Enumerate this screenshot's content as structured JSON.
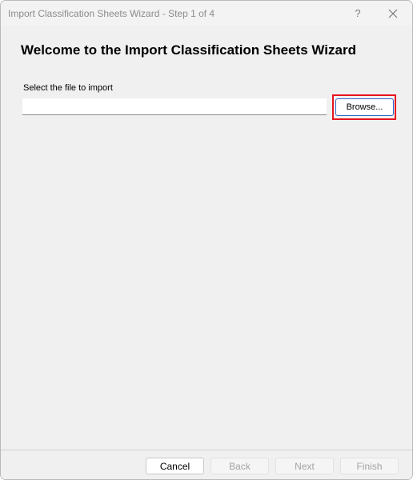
{
  "window": {
    "title": "Import Classification Sheets Wizard - Step 1 of 4",
    "help_glyph": "?",
    "close_icon": "close-icon"
  },
  "page": {
    "heading": "Welcome to the Import Classification Sheets Wizard",
    "file_label": "Select the file to import",
    "file_value": "",
    "browse_label": "Browse..."
  },
  "footer": {
    "cancel_label": "Cancel",
    "back_label": "Back",
    "next_label": "Next",
    "finish_label": "Finish"
  },
  "colors": {
    "highlight": "#e8141e",
    "focus_border": "#2f66c7",
    "window_bg": "#f0f0f0"
  }
}
